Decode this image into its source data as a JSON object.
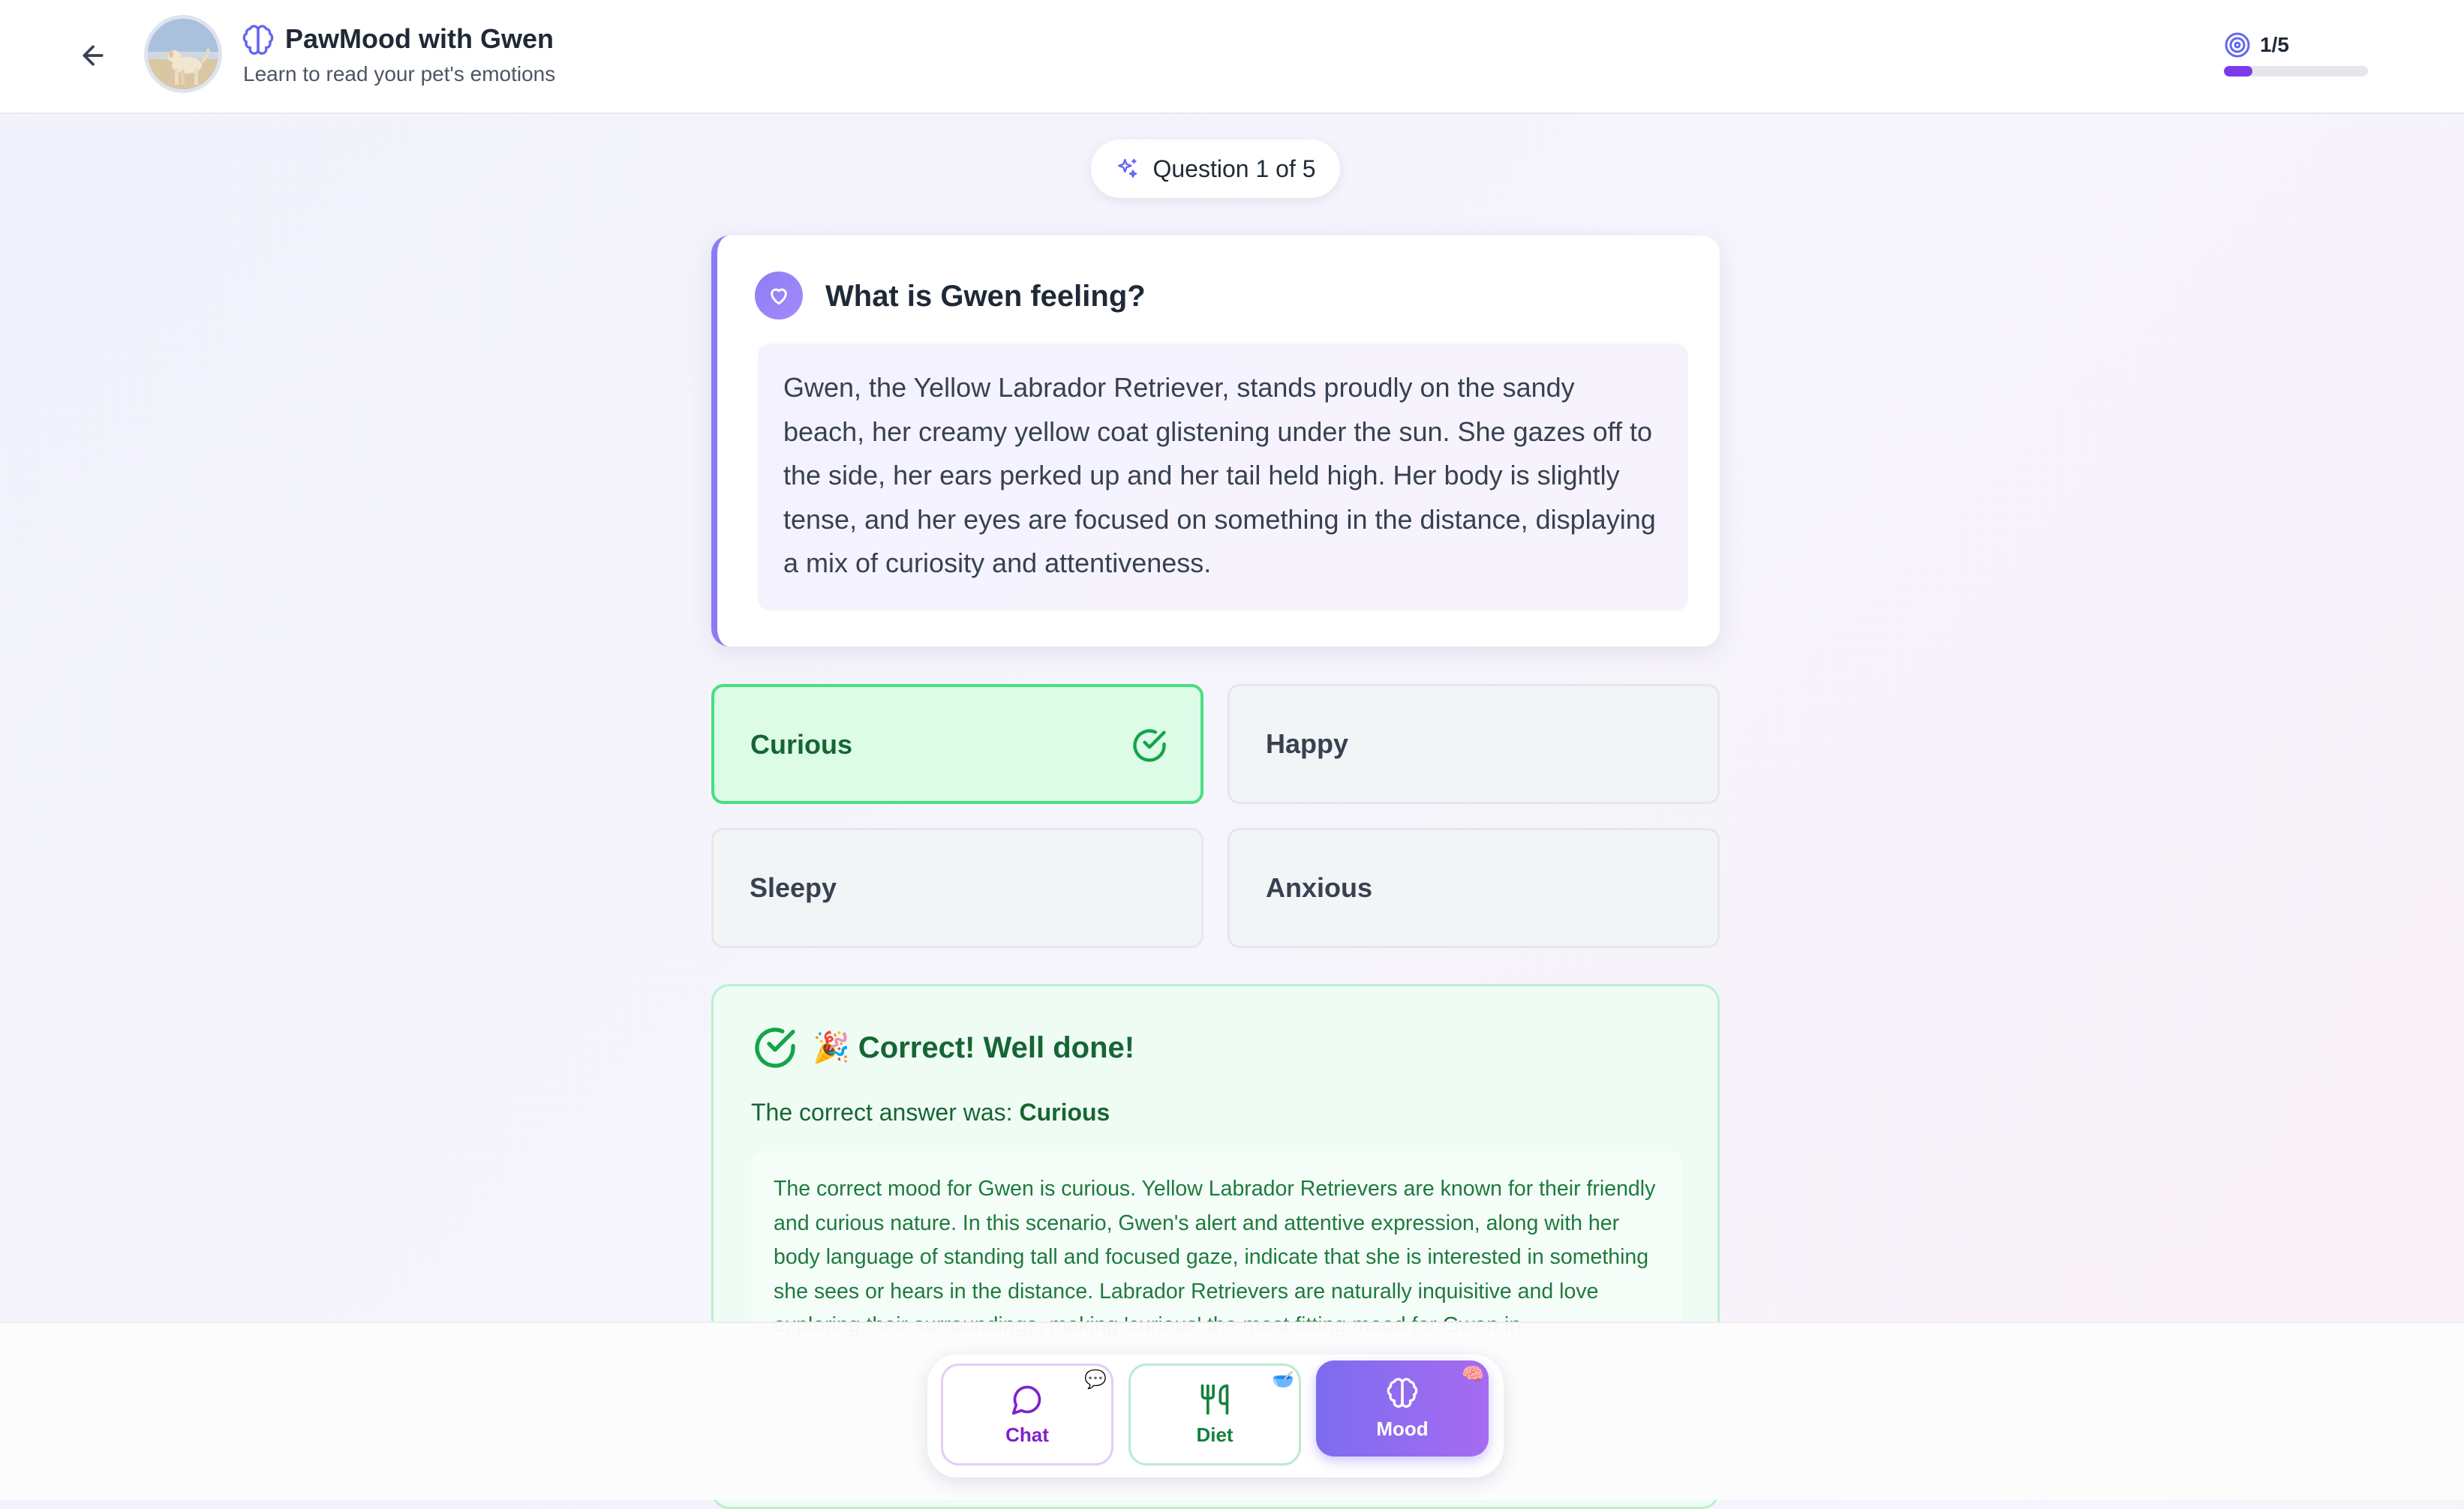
{
  "header": {
    "title": "PawMood with Gwen",
    "subtitle": "Learn to read your pet's emotions",
    "progress_text": "1/5",
    "progress_fraction": 0.2,
    "icons": {
      "back": "arrow-left-icon",
      "app": "brain-icon",
      "progress": "target-icon"
    }
  },
  "question": {
    "pill_label": "Question 1 of 5",
    "title": "What is Gwen feeling?",
    "description": "Gwen, the Yellow Labrador Retriever, stands proudly on the sandy beach, her creamy yellow coat glistening under the sun. She gazes off to the side, her ears perked up and her tail held high. Her body is slightly tense, and her eyes are focused on something in the distance, displaying a mix of curiosity and attentiveness."
  },
  "options": [
    {
      "label": "Curious",
      "correct": true
    },
    {
      "label": "Happy",
      "correct": false
    },
    {
      "label": "Sleepy",
      "correct": false
    },
    {
      "label": "Anxious",
      "correct": false
    }
  ],
  "result": {
    "title": "🎉 Correct! Well done!",
    "answer_prefix": "The correct answer was:",
    "answer_value": "Curious",
    "explanation": "The correct mood for Gwen is curious. Yellow Labrador Retrievers are known for their friendly and curious nature. In this scenario, Gwen's alert and attentive expression, along with her body language of standing tall and focused gaze, indicate that she is interested in something she sees or hears in the distance. Labrador Retrievers are naturally inquisitive and love exploring their surroundings, making 'curious' the most fitting mood for Gwen in"
  },
  "nav": [
    {
      "label": "Chat",
      "icon": "message-circle-icon",
      "active": false
    },
    {
      "label": "Diet",
      "icon": "utensils-icon",
      "active": false
    },
    {
      "label": "Mood",
      "icon": "brain-icon",
      "active": true
    }
  ],
  "colors": {
    "accent": "#7c3aed",
    "correct_green": "#4ade80",
    "correct_text": "#166534",
    "mood_gradient_start": "#7c6cf0",
    "mood_gradient_end": "#a66bf0"
  }
}
